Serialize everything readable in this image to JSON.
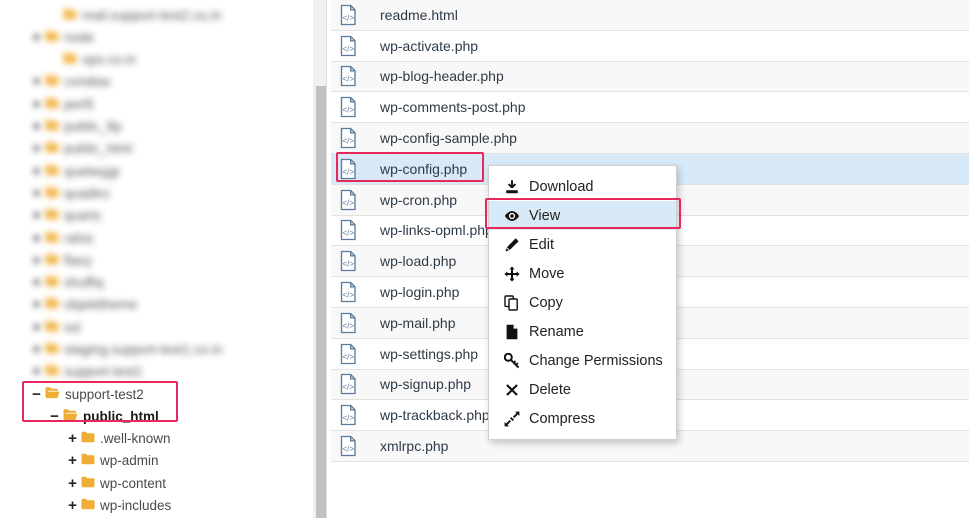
{
  "colors": {
    "annotation": "#e8275a",
    "selection": "#d8eaf8",
    "folder": "#f0ad35",
    "file_icon": "#5b7c9d",
    "scrollbar_thumb": "#c1c1c1",
    "row_stripe": "#f8f8f8"
  },
  "tree": {
    "items": [
      {
        "label": "mail.support-test2.co.in",
        "toggle": "",
        "indent": 2,
        "blurred": true,
        "bold": false,
        "open": false
      },
      {
        "label": "node",
        "toggle": "+",
        "indent": 1,
        "blurred": true,
        "bold": false,
        "open": false
      },
      {
        "label": "ops.co.in",
        "toggle": "",
        "indent": 2,
        "blurred": true,
        "bold": false,
        "open": false
      },
      {
        "label": "condias",
        "toggle": "+",
        "indent": 1,
        "blurred": true,
        "bold": false,
        "open": false
      },
      {
        "label": "perl5",
        "toggle": "+",
        "indent": 1,
        "blurred": true,
        "bold": false,
        "open": false
      },
      {
        "label": "public_ftp",
        "toggle": "+",
        "indent": 1,
        "blurred": true,
        "bold": false,
        "open": false
      },
      {
        "label": "public_html",
        "toggle": "+",
        "indent": 1,
        "blurred": true,
        "bold": false,
        "open": false
      },
      {
        "label": "quebeggi",
        "toggle": "+",
        "indent": 1,
        "blurred": true,
        "bold": false,
        "open": false
      },
      {
        "label": "quadtro",
        "toggle": "+",
        "indent": 1,
        "blurred": true,
        "bold": false,
        "open": false
      },
      {
        "label": "quartz",
        "toggle": "+",
        "indent": 1,
        "blurred": true,
        "bold": false,
        "open": false
      },
      {
        "label": "rahis",
        "toggle": "+",
        "indent": 1,
        "blurred": true,
        "bold": false,
        "open": false
      },
      {
        "label": "flaxy",
        "toggle": "+",
        "indent": 1,
        "blurred": true,
        "bold": false,
        "open": false
      },
      {
        "label": "shuffiq",
        "toggle": "+",
        "indent": 1,
        "blurred": true,
        "bold": false,
        "open": false
      },
      {
        "label": "objekttheme",
        "toggle": "+",
        "indent": 1,
        "blurred": true,
        "bold": false,
        "open": false
      },
      {
        "label": "ssl",
        "toggle": "+",
        "indent": 1,
        "blurred": true,
        "bold": false,
        "open": false
      },
      {
        "label": "staging.support-test1.co.in",
        "toggle": "+",
        "indent": 1,
        "blurred": true,
        "bold": false,
        "open": false
      },
      {
        "label": "support-test1",
        "toggle": "+",
        "indent": 1,
        "blurred": true,
        "bold": false,
        "open": false
      },
      {
        "label": "support-test2",
        "toggle": "−",
        "indent": 1,
        "blurred": false,
        "bold": false,
        "open": true
      },
      {
        "label": "public_html",
        "toggle": "−",
        "indent": 2,
        "blurred": false,
        "bold": true,
        "open": true
      },
      {
        "label": ".well-known",
        "toggle": "+",
        "indent": 3,
        "blurred": false,
        "bold": false,
        "open": false
      },
      {
        "label": "wp-admin",
        "toggle": "+",
        "indent": 3,
        "blurred": false,
        "bold": false,
        "open": false
      },
      {
        "label": "wp-content",
        "toggle": "+",
        "indent": 3,
        "blurred": false,
        "bold": false,
        "open": false
      },
      {
        "label": "wp-includes",
        "toggle": "+",
        "indent": 3,
        "blurred": false,
        "bold": false,
        "open": false
      }
    ]
  },
  "files": {
    "rows": [
      {
        "name": "readme.html",
        "selected": false
      },
      {
        "name": "wp-activate.php",
        "selected": false
      },
      {
        "name": "wp-blog-header.php",
        "selected": false
      },
      {
        "name": "wp-comments-post.php",
        "selected": false
      },
      {
        "name": "wp-config-sample.php",
        "selected": false
      },
      {
        "name": "wp-config.php",
        "selected": true
      },
      {
        "name": "wp-cron.php",
        "selected": false
      },
      {
        "name": "wp-links-opml.php",
        "selected": false
      },
      {
        "name": "wp-load.php",
        "selected": false
      },
      {
        "name": "wp-login.php",
        "selected": false
      },
      {
        "name": "wp-mail.php",
        "selected": false
      },
      {
        "name": "wp-settings.php",
        "selected": false
      },
      {
        "name": "wp-signup.php",
        "selected": false
      },
      {
        "name": "wp-trackback.php",
        "selected": false
      },
      {
        "name": "xmlrpc.php",
        "selected": false
      }
    ]
  },
  "context_menu": {
    "items": [
      {
        "label": "Download",
        "icon": "download-icon",
        "active": false
      },
      {
        "label": "View",
        "icon": "eye-icon",
        "active": true
      },
      {
        "label": "Edit",
        "icon": "pencil-icon",
        "active": false
      },
      {
        "label": "Move",
        "icon": "move-arrows-icon",
        "active": false
      },
      {
        "label": "Copy",
        "icon": "copy-icon",
        "active": false
      },
      {
        "label": "Rename",
        "icon": "page-icon",
        "active": false
      },
      {
        "label": "Change Permissions",
        "icon": "key-icon",
        "active": false
      },
      {
        "label": "Delete",
        "icon": "x-icon",
        "active": false
      },
      {
        "label": "Compress",
        "icon": "compress-arrows-icon",
        "active": false
      }
    ]
  }
}
